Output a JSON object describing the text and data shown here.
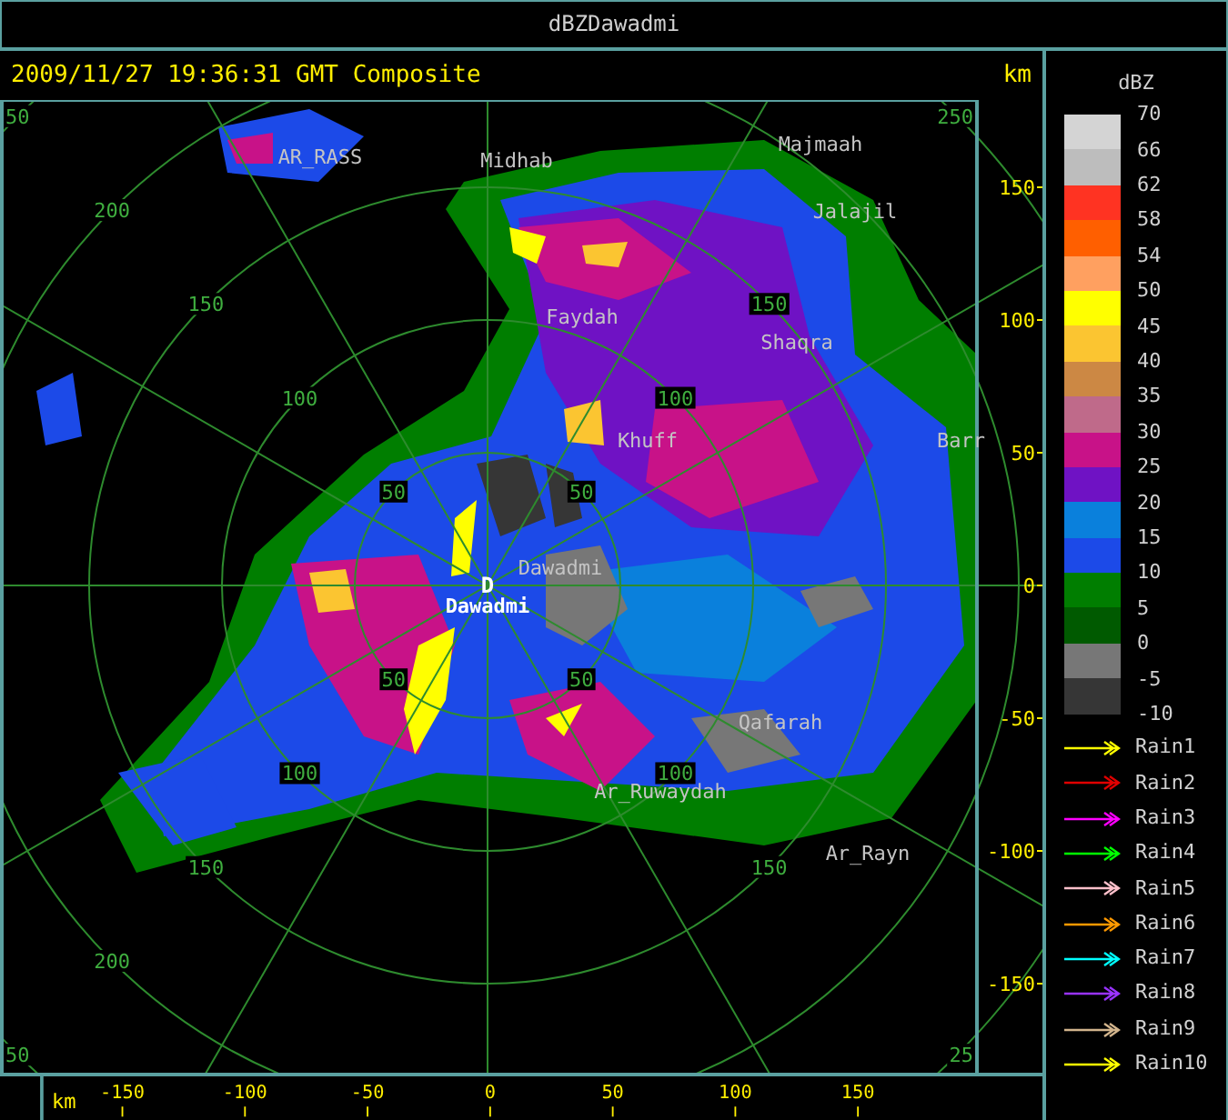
{
  "window": {
    "title": "dBZDawadmi"
  },
  "header": {
    "timestamp": "2009/11/27 19:36:31 GMT Composite",
    "unit": "km"
  },
  "map": {
    "range_labels": [
      "50",
      "250",
      "200",
      "150",
      "150",
      "100",
      "100",
      "50",
      "50",
      "50",
      "50",
      "100",
      "100",
      "150",
      "150",
      "200",
      "50",
      "25"
    ],
    "places": [
      {
        "name": "AR_RASS"
      },
      {
        "name": "Midhab"
      },
      {
        "name": "Majmaah"
      },
      {
        "name": "Jalajil"
      },
      {
        "name": "Faydah"
      },
      {
        "name": "Shaqra"
      },
      {
        "name": "Khuff"
      },
      {
        "name": "Barr"
      },
      {
        "name": "Dawadmi"
      },
      {
        "name": "Qafarah"
      },
      {
        "name": "Ar_Ruwaydah"
      },
      {
        "name": "Ar_Rayn"
      }
    ],
    "station": {
      "marker": "D",
      "name": "Dawadmi"
    }
  },
  "y_axis": {
    "labels": [
      "150",
      "100",
      "50",
      "0",
      "-50",
      "-100",
      "-150"
    ]
  },
  "x_axis": {
    "unit": "km",
    "labels": [
      "-150",
      "-100",
      "-50",
      "0",
      "50",
      "100",
      "150"
    ]
  },
  "legend": {
    "title": "dBZ",
    "scale": [
      {
        "color": "#d4d4d4"
      },
      {
        "color": "#bdbdbd"
      },
      {
        "color": "#ff3322"
      },
      {
        "color": "#ff5f00"
      },
      {
        "color": "#ffa060"
      },
      {
        "color": "#ffff00"
      },
      {
        "color": "#fbc531"
      },
      {
        "color": "#cc8844"
      },
      {
        "color": "#bf6a8a"
      },
      {
        "color": "#c81288"
      },
      {
        "color": "#6f12c4"
      },
      {
        "color": "#0a80dc"
      },
      {
        "color": "#1c4ae8"
      },
      {
        "color": "#007e00"
      },
      {
        "color": "#005a00"
      },
      {
        "color": "#777777"
      },
      {
        "color": "#363636"
      }
    ],
    "scale_labels": [
      "70",
      "66",
      "62",
      "58",
      "54",
      "50",
      "45",
      "40",
      "35",
      "30",
      "25",
      "20",
      "15",
      "10",
      "5",
      "0",
      "-5",
      "-10"
    ],
    "tracks": [
      {
        "name": "Rain1",
        "color": "#ffff00"
      },
      {
        "name": "Rain2",
        "color": "#e00000"
      },
      {
        "name": "Rain3",
        "color": "#ff00ff"
      },
      {
        "name": "Rain4",
        "color": "#00ff00"
      },
      {
        "name": "Rain5",
        "color": "#ffc0cb"
      },
      {
        "name": "Rain6",
        "color": "#ff9900"
      },
      {
        "name": "Rain7",
        "color": "#00ffff"
      },
      {
        "name": "Rain8",
        "color": "#9933ff"
      },
      {
        "name": "Rain9",
        "color": "#d2b48c"
      },
      {
        "name": "Rain10",
        "color": "#ffff00"
      }
    ]
  }
}
